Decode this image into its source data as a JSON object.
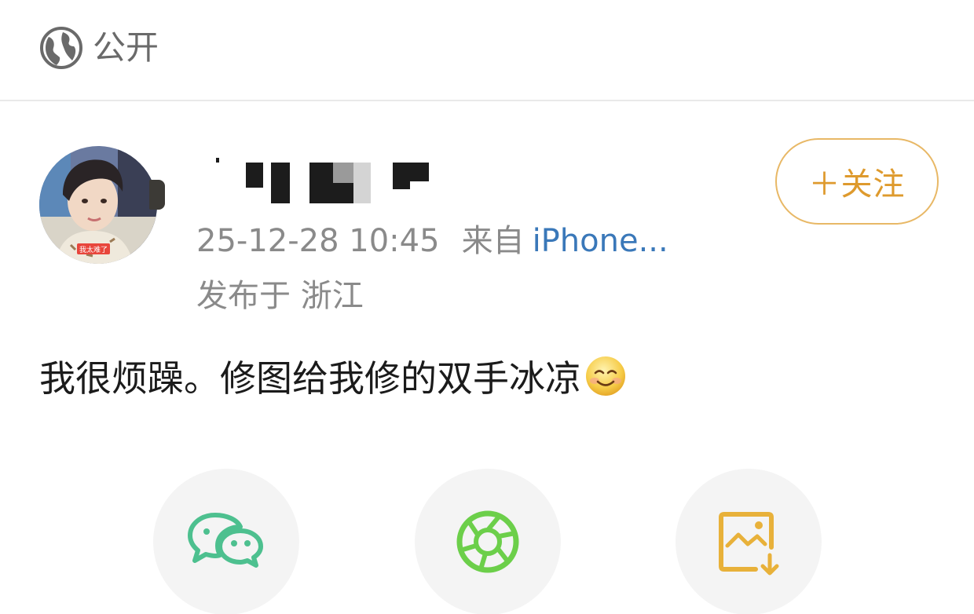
{
  "visibility": {
    "label": "公开",
    "icon": "globe-icon"
  },
  "post": {
    "avatar_caption": "我太难了",
    "follow_button": {
      "label": "＋关注",
      "accent": "#e8b866",
      "text_color": "#de9a2d"
    },
    "timestamp": "25-12-28 10:45",
    "source_prefix": "来自",
    "source_device": "iPhone...",
    "location": "发布于 浙江",
    "text": "我很烦躁。修图给我修的双手冰凉",
    "emoji": "smile-emoji"
  },
  "share_buttons": [
    {
      "name": "wechat",
      "icon": "wechat-icon",
      "color": "#4dc08f"
    },
    {
      "name": "moments",
      "icon": "moments-icon",
      "color": "#6ccf4a"
    },
    {
      "name": "save-image",
      "icon": "save-image-icon",
      "color": "#e8b13a"
    }
  ]
}
